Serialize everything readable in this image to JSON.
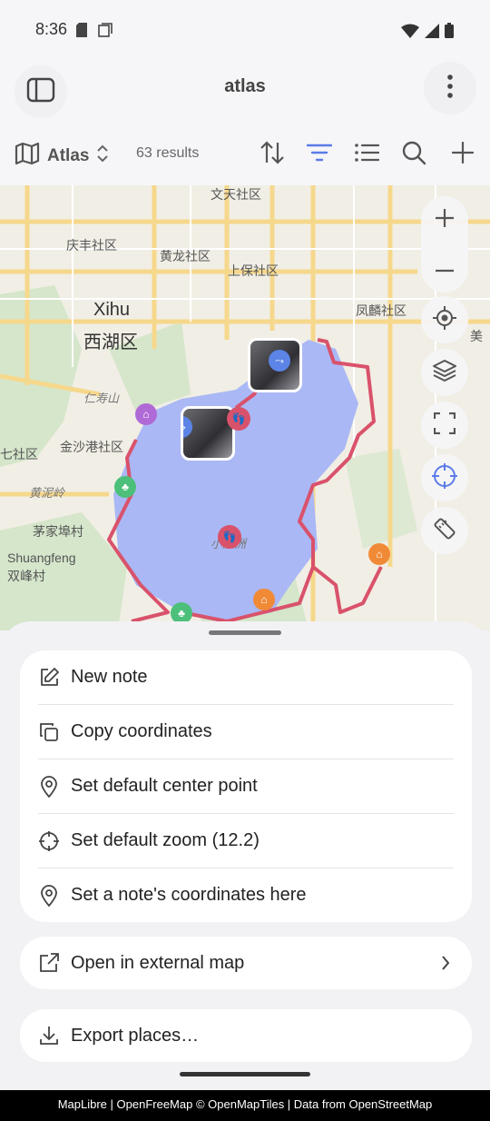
{
  "status_bar": {
    "time": "8:36"
  },
  "app_bar": {
    "title": "atlas"
  },
  "toolbar": {
    "atlas_name": "Atlas",
    "results": "63 results"
  },
  "map": {
    "labels": {
      "wentian": "文天社区",
      "qingfeng": "庆丰社区",
      "huanglong": "黄龙社区",
      "shangbao": "上保社区",
      "xihu_en": "Xihu",
      "xihu_zh": "西湖区",
      "fenglin": "凤麟社区",
      "renshou": "仁寿山",
      "jinshagang": "金沙港社区",
      "qi": "七社区",
      "huangniling": "黄泥岭",
      "maojiabu": "茅家埠村",
      "shuangfeng_en": "Shuangfeng",
      "shuangfeng_zh": "双峰村",
      "xiaoying": "小瀛洲",
      "edge_right": "美"
    },
    "colors": {
      "water": "#aab8f5",
      "route": "#d9526b",
      "park": "#cfe3c6",
      "road": "#f6d88c"
    }
  },
  "menu": {
    "items": [
      {
        "label": "New note",
        "icon": "edit-icon"
      },
      {
        "label": "Copy coordinates",
        "icon": "copy-icon"
      },
      {
        "label": "Set default center point",
        "icon": "location-pin-icon"
      },
      {
        "label": "Set default zoom (12.2)",
        "icon": "crosshair-icon"
      },
      {
        "label": "Set a note's coordinates here",
        "icon": "location-pin-icon"
      }
    ],
    "external_map": {
      "label": "Open in external map",
      "icon": "external-link-icon"
    },
    "export": {
      "label": "Export places…",
      "icon": "download-icon"
    }
  },
  "attribution": "MapLibre | OpenFreeMap © OpenMapTiles | Data from OpenStreetMap"
}
